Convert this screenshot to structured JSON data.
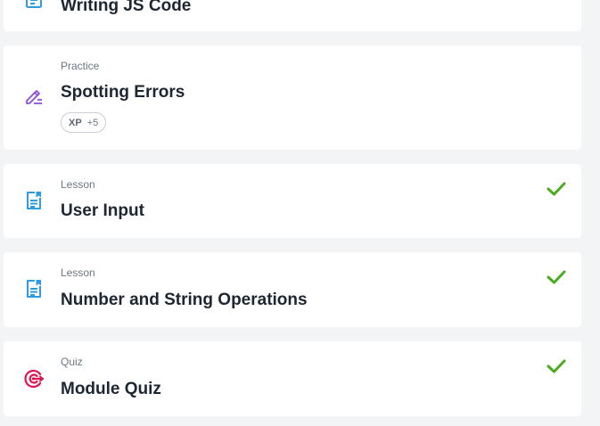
{
  "items": [
    {
      "type": "",
      "title": "Writing JS Code",
      "icon": "document-icon",
      "completed": false
    },
    {
      "type": "Practice",
      "title": "Spotting Errors",
      "icon": "pencil-lines-icon",
      "completed": false,
      "xp_label": "XP",
      "xp_value": "+5"
    },
    {
      "type": "Lesson",
      "title": "User Input",
      "icon": "document-icon",
      "completed": true
    },
    {
      "type": "Lesson",
      "title": "Number and String Operations",
      "icon": "document-icon",
      "completed": true
    },
    {
      "type": "Quiz",
      "title": "Module Quiz",
      "icon": "target-arrow-icon",
      "completed": true
    }
  ],
  "colors": {
    "lesson_icon": "#2f9be0",
    "practice_icon": "#8a4fd6",
    "quiz_icon": "#e0144f",
    "check": "#4aab1e"
  }
}
